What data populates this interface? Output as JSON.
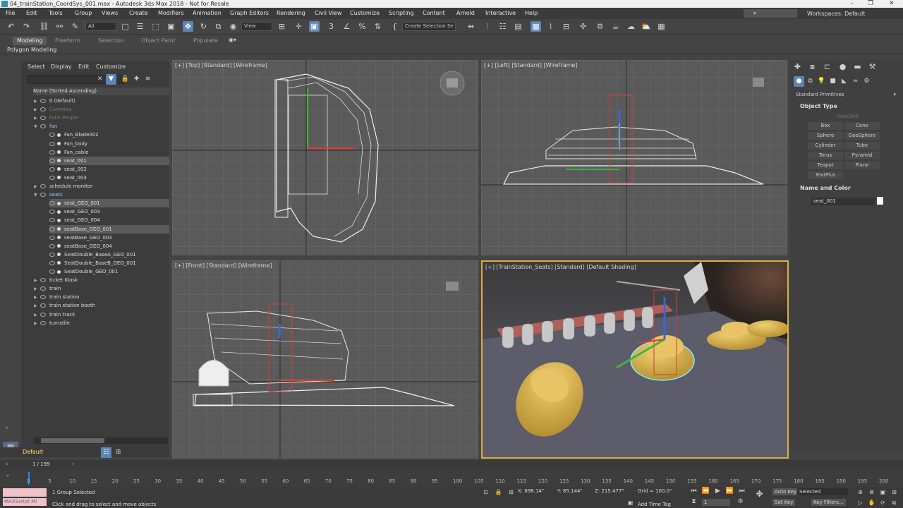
{
  "window": {
    "title": "04_trainStation_CoordSys_001.max - Autodesk 3ds Max 2018 - Not for Resale"
  },
  "menu": [
    "File",
    "Edit",
    "Tools",
    "Group",
    "Views",
    "Create",
    "Modifiers",
    "Animation",
    "Graph Editors",
    "Rendering",
    "Civil View",
    "Customize",
    "Scripting",
    "Content",
    "Arnold",
    "Interactive",
    "Help"
  ],
  "workspace": {
    "label": "Workspaces:",
    "value": "Default"
  },
  "toolbar": {
    "filter": "All",
    "refcoord": "View",
    "selection_set": "Create Selection Se"
  },
  "ribbon": {
    "tabs": [
      "Modeling",
      "Freeform",
      "Selection",
      "Object Paint",
      "Populate"
    ],
    "active": "Modeling",
    "subpanel": "Polygon Modeling"
  },
  "explorer": {
    "menu": [
      "Select",
      "Display",
      "Edit",
      "Customize"
    ],
    "header": "Name (Sorted Ascending)",
    "rows": [
      {
        "label": "0 (default)",
        "indent": 1,
        "kind": "layer"
      },
      {
        "label": "Cameras",
        "indent": 1,
        "kind": "dim"
      },
      {
        "label": "Fake People",
        "indent": 1,
        "kind": "dim"
      },
      {
        "label": "fan",
        "indent": 1,
        "kind": "grp"
      },
      {
        "label": "Fan_Blade002",
        "indent": 2,
        "kind": "obj"
      },
      {
        "label": "Fan_body",
        "indent": 2,
        "kind": "obj"
      },
      {
        "label": "Fan_cable",
        "indent": 2,
        "kind": "obj"
      },
      {
        "label": "seat_001",
        "indent": 2,
        "kind": "sel"
      },
      {
        "label": "seat_002",
        "indent": 2,
        "kind": "obj"
      },
      {
        "label": "seat_003",
        "indent": 2,
        "kind": "obj"
      },
      {
        "label": "schedule monitor",
        "indent": 1,
        "kind": "layer"
      },
      {
        "label": "seats",
        "indent": 1,
        "kind": "grp"
      },
      {
        "label": "seat_GEO_001",
        "indent": 2,
        "kind": "sel"
      },
      {
        "label": "seat_GEO_003",
        "indent": 2,
        "kind": "obj"
      },
      {
        "label": "seat_GEO_004",
        "indent": 2,
        "kind": "obj"
      },
      {
        "label": "seatBase_GEO_001",
        "indent": 2,
        "kind": "sel"
      },
      {
        "label": "seatBase_GEO_003",
        "indent": 2,
        "kind": "obj"
      },
      {
        "label": "seatBase_GEO_004",
        "indent": 2,
        "kind": "obj"
      },
      {
        "label": "SeatDouble_BaseA_GEO_001",
        "indent": 2,
        "kind": "obj"
      },
      {
        "label": "SeatDouble_BaseB_GEO_001",
        "indent": 2,
        "kind": "obj"
      },
      {
        "label": "SeatDouble_GEO_001",
        "indent": 2,
        "kind": "obj"
      },
      {
        "label": "ticket Kiosk",
        "indent": 1,
        "kind": "layer"
      },
      {
        "label": "train",
        "indent": 1,
        "kind": "layer"
      },
      {
        "label": "train station",
        "indent": 1,
        "kind": "layer"
      },
      {
        "label": "train station booth",
        "indent": 1,
        "kind": "layer"
      },
      {
        "label": "train track",
        "indent": 1,
        "kind": "layer"
      },
      {
        "label": "turnstile",
        "indent": 1,
        "kind": "layer"
      }
    ]
  },
  "layer": "Default",
  "viewports": {
    "top": "[+] [Top] [Standard] [Wireframe]",
    "left": "[+] [Left] [Standard] [Wireframe]",
    "front": "[+] [Front] [Standard] [Wireframe]",
    "persp": "[+] [TrainStation_Seats] [Standard] [Default Shading]"
  },
  "command_panel": {
    "category": "Standard Primitives",
    "object_type_title": "Object Type",
    "autogrid": "AutoGrid",
    "buttons": [
      "Box",
      "Cone",
      "Sphere",
      "GeoSphere",
      "Cylinder",
      "Tube",
      "Torus",
      "Pyramid",
      "Teapot",
      "Plane",
      "TextPlus"
    ],
    "name_color_title": "Name and Color",
    "object_name": "seat_001"
  },
  "timeline": {
    "frame": "1 / 199",
    "ticks": [
      "0",
      "5",
      "10",
      "15",
      "20",
      "25",
      "30",
      "35",
      "40",
      "45",
      "50",
      "55",
      "60",
      "65",
      "70",
      "75",
      "80",
      "85",
      "90",
      "95",
      "100",
      "105",
      "110",
      "115",
      "120",
      "125",
      "130",
      "135",
      "140",
      "145",
      "150",
      "155",
      "160",
      "165",
      "170",
      "175",
      "180",
      "185",
      "190",
      "195",
      "200"
    ]
  },
  "status": {
    "selected": "1 Group Selected",
    "prompt": "Click and drag to select and move objects",
    "x": "X: 698.14\"",
    "y": "Y: 85.144\"",
    "z": "Z: 215.477\"",
    "grid": "Grid = 100.0\"",
    "auto_key": "Auto Key",
    "set_key": "Set Key",
    "selected_dropdown": "Selected",
    "key_filters": "Key Filters...",
    "add_time_tag": "Add Time Tag",
    "frame_field": "1",
    "maxscript": "MAXScript Mi"
  }
}
